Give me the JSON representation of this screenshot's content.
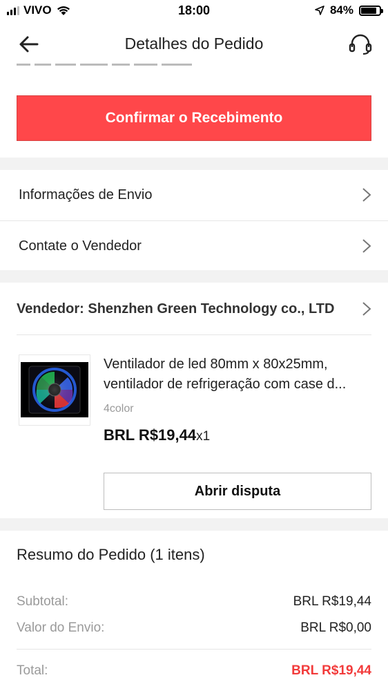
{
  "status_bar": {
    "carrier": "VIVO",
    "time": "18:00",
    "battery": "84%",
    "battery_level": 0.84
  },
  "header": {
    "title": "Detalhes do Pedido",
    "back_icon": "arrow-left-icon",
    "support_icon": "headset-icon"
  },
  "actions": {
    "confirm_label": "Confirmar o Recebimento",
    "confirm_color": "#ff474a"
  },
  "menu": {
    "shipping_info": "Informações de Envio",
    "contact_seller": "Contate o Vendedor"
  },
  "seller": {
    "label": "Vendedor: Shenzhen Green Technology co., LTD"
  },
  "product": {
    "title_line1": "Ventilador de led 80mm x 80x25mm,",
    "title_line2": "ventilador de refrigeração com case d...",
    "variant": "4color",
    "price": "BRL R$19,44",
    "quantity": "x1",
    "dispute_label": "Abrir disputa"
  },
  "summary": {
    "title": "Resumo do Pedido (1 itens)",
    "subtotal_label": "Subtotal:",
    "subtotal_value": "BRL R$19,44",
    "shipping_label": "Valor do Envio:",
    "shipping_value": "BRL R$0,00",
    "total_label": "Total:",
    "total_value": "BRL R$19,44",
    "total_color": "#f23b3b"
  }
}
